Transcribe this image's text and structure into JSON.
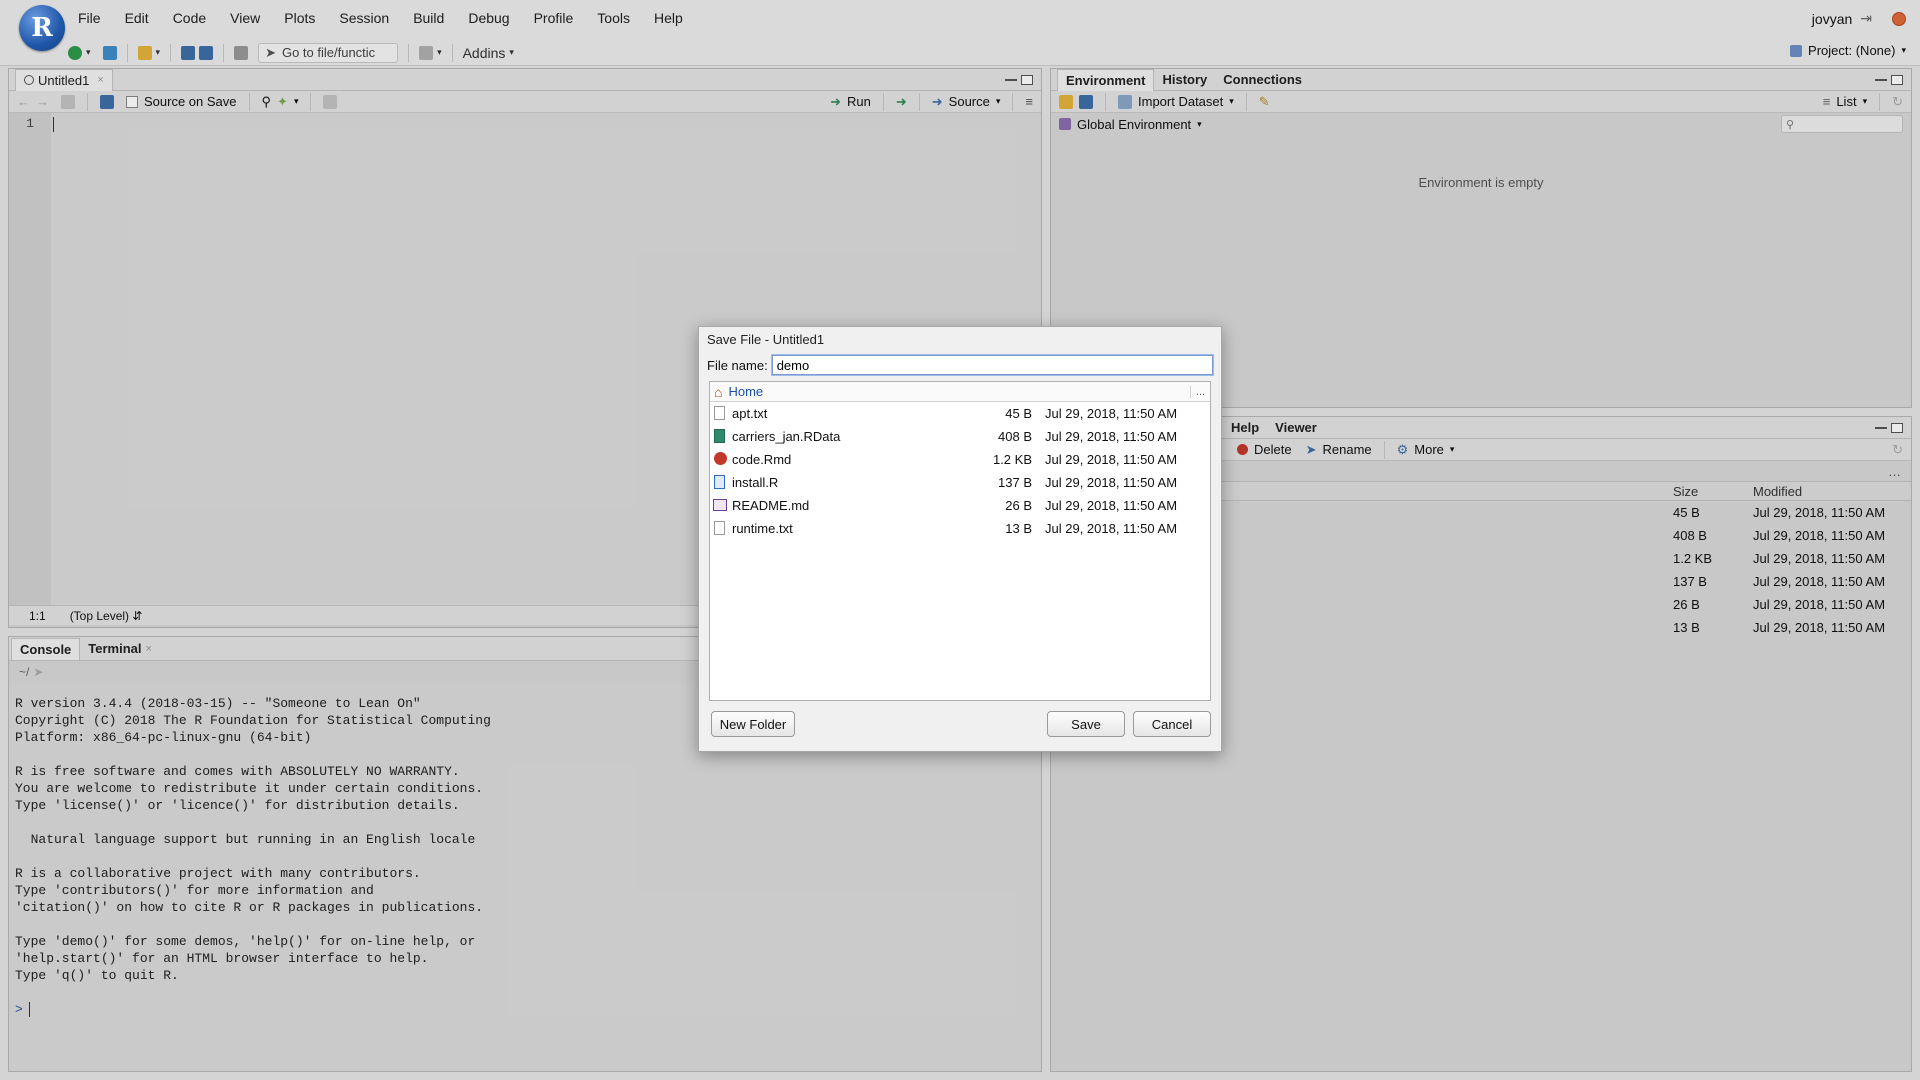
{
  "menu": [
    "File",
    "Edit",
    "Code",
    "View",
    "Plots",
    "Session",
    "Build",
    "Debug",
    "Profile",
    "Tools",
    "Help"
  ],
  "user": "jovyan",
  "toolbar": {
    "goto_placeholder": "Go to file/functic",
    "addins": "Addins",
    "project": "Project: (None)"
  },
  "editor": {
    "tab": "Untitled1",
    "source_on_save": "Source on Save",
    "run": "Run",
    "source": "Source",
    "line_number": "1",
    "position": "1:1",
    "scope": "(Top Level)"
  },
  "console": {
    "tabs": [
      "Console",
      "Terminal"
    ],
    "path": "~/",
    "lines": [
      "R version 3.4.4 (2018-03-15) -- \"Someone to Lean On\"",
      "Copyright (C) 2018 The R Foundation for Statistical Computing",
      "Platform: x86_64-pc-linux-gnu (64-bit)",
      "",
      "R is free software and comes with ABSOLUTELY NO WARRANTY.",
      "You are welcome to redistribute it under certain conditions.",
      "Type 'license()' or 'licence()' for distribution details.",
      "",
      "  Natural language support but running in an English locale",
      "",
      "R is a collaborative project with many contributors.",
      "Type 'contributors()' for more information and",
      "'citation()' on how to cite R or R packages in publications.",
      "",
      "Type 'demo()' for some demos, 'help()' for on-line help, or",
      "'help.start()' for an HTML browser interface to help.",
      "Type 'q()' to quit R."
    ],
    "prompt": ">"
  },
  "environment": {
    "tabs": [
      "Environment",
      "History",
      "Connections"
    ],
    "import_dataset": "Import Dataset",
    "list": "List",
    "scope": "Global Environment",
    "empty": "Environment is empty"
  },
  "files_pane": {
    "tabs": [
      "Help",
      "Viewer"
    ],
    "delete": "Delete",
    "rename": "Rename",
    "more": "More",
    "col_size": "Size",
    "col_modified": "Modified",
    "rows": [
      {
        "size": "45 B",
        "modified": "Jul 29, 2018, 11:50 AM"
      },
      {
        "size": "408 B",
        "modified": "Jul 29, 2018, 11:50 AM"
      },
      {
        "size": "1.2 KB",
        "modified": "Jul 29, 2018, 11:50 AM"
      },
      {
        "size": "137 B",
        "modified": "Jul 29, 2018, 11:50 AM"
      },
      {
        "size": "26 B",
        "modified": "Jul 29, 2018, 11:50 AM"
      },
      {
        "size": "13 B",
        "modified": "Jul 29, 2018, 11:50 AM"
      }
    ]
  },
  "dialog": {
    "title": "Save File - Untitled1",
    "file_name_label": "File name:",
    "file_name_value": "demo",
    "location": "Home",
    "more": "...",
    "files": [
      {
        "name": "apt.txt",
        "size": "45 B",
        "modified": "Jul 29, 2018, 11:50 AM",
        "icon": "text-file-icon",
        "color": "#ffffff"
      },
      {
        "name": "carriers_jan.RData",
        "size": "408 B",
        "modified": "Jul 29, 2018, 11:50 AM",
        "icon": "rdata-file-icon",
        "color": "#2e8b6e"
      },
      {
        "name": "code.Rmd",
        "size": "1.2 KB",
        "modified": "Jul 29, 2018, 11:50 AM",
        "icon": "rmd-file-icon",
        "color": "#c0392b"
      },
      {
        "name": "install.R",
        "size": "137 B",
        "modified": "Jul 29, 2018, 11:50 AM",
        "icon": "r-script-icon",
        "color": "#2c6fbf"
      },
      {
        "name": "README.md",
        "size": "26 B",
        "modified": "Jul 29, 2018, 11:50 AM",
        "icon": "markdown-file-icon",
        "color": "#6b3fa0"
      },
      {
        "name": "runtime.txt",
        "size": "13 B",
        "modified": "Jul 29, 2018, 11:50 AM",
        "icon": "text-file-icon",
        "color": "#ffffff"
      }
    ],
    "new_folder": "New Folder",
    "save": "Save",
    "cancel": "Cancel"
  }
}
